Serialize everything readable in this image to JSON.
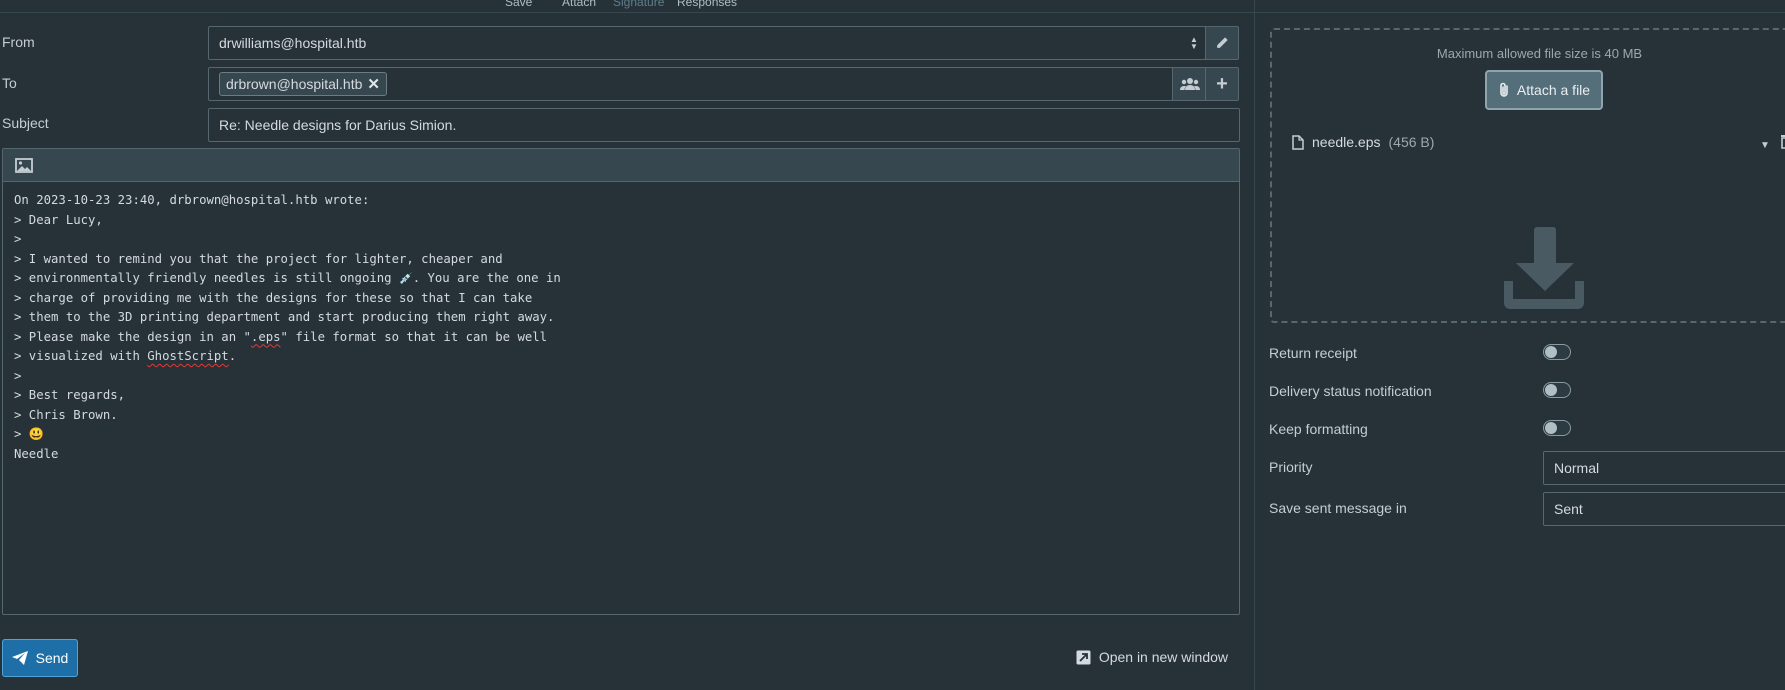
{
  "toolbar": {
    "save_label": "Save",
    "attach_label": "Attach",
    "signature_label": "Signature",
    "responses_label": "Responses"
  },
  "compose": {
    "from_label": "From",
    "from_value": "drwilliams@hospital.htb",
    "to_label": "To",
    "recipients": [
      "drbrown@hospital.htb"
    ],
    "subject_label": "Subject",
    "subject_value": "Re: Needle designs for Darius Simion.",
    "body": {
      "l1": "On 2023-10-23 23:40, drbrown@hospital.htb wrote:",
      "l2": "> Dear Lucy,",
      "l3": ">",
      "l4": "> I wanted to remind you that the project for lighter, cheaper and",
      "l5a": "> environmentally friendly needles is still ongoing ",
      "l5emoji": "💉",
      "l5b": ". You are the one in",
      "l6": "> charge of providing me with the designs for these so that I can take",
      "l7": "> them to the 3D printing department and start producing them right away.",
      "l8a": "> Please make the design in an \"",
      "l8b": ".eps",
      "l8c": "\" file format so that it can be well",
      "l9a": "> visualized with ",
      "l9b": "GhostScript",
      "l9c": ".",
      "l10": ">",
      "l11": "> Best regards,",
      "l12": "> Chris Brown.",
      "l13a": "> ",
      "l13emoji": "😃",
      "l14": "Needle"
    },
    "send_label": "Send",
    "open_new_window_label": "Open in new window"
  },
  "attachments": {
    "max_size_text": "Maximum allowed file size is 40 MB",
    "attach_button_label": "Attach a file",
    "file_name": "needle.eps",
    "file_size": "(456 B)"
  },
  "options": {
    "return_receipt_label": "Return receipt",
    "return_receipt_on": false,
    "dsn_label": "Delivery status notification",
    "dsn_on": false,
    "keep_formatting_label": "Keep formatting",
    "keep_formatting_on": false,
    "priority_label": "Priority",
    "priority_value": "Normal",
    "save_sent_label": "Save sent message in",
    "save_sent_value": "Sent"
  },
  "colors": {
    "background": "#263238",
    "send_button": "#1e6fa8",
    "field_border": "#56676f"
  }
}
